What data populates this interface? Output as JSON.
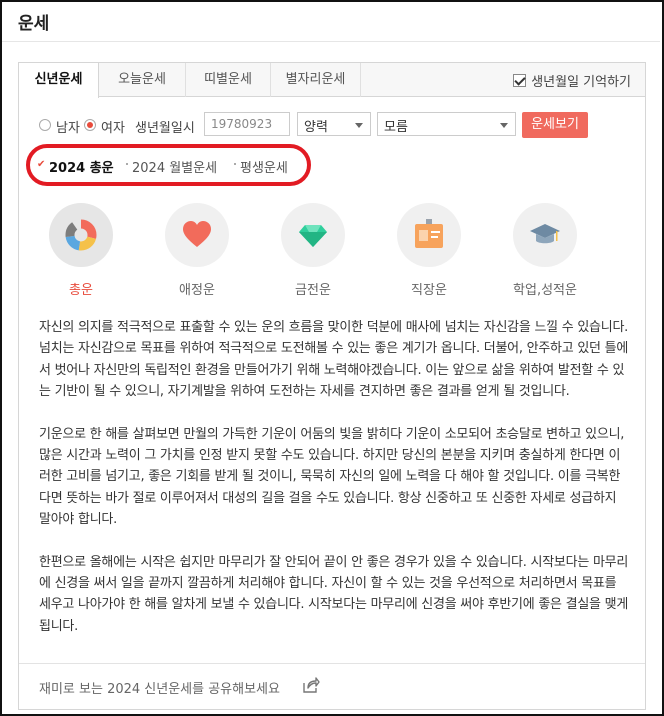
{
  "header": {
    "title": "운세"
  },
  "tabs": [
    {
      "label": "신년운세",
      "active": true
    },
    {
      "label": "오늘운세",
      "active": false
    },
    {
      "label": "띠별운세",
      "active": false
    },
    {
      "label": "별자리운세",
      "active": false
    }
  ],
  "remember_label": "생년월일 기억하기",
  "form": {
    "male_label": "남자",
    "female_label": "여자",
    "selected_gender": "여자",
    "birth_label": "생년월일시",
    "birth_placeholder": "19780923",
    "calendar_value": "양력",
    "time_value": "모름",
    "submit_label": "운세보기"
  },
  "subtabs": [
    {
      "label": "2024 총운",
      "active": true
    },
    {
      "label": "2024 월별운세",
      "active": false
    },
    {
      "label": "평생운세",
      "active": false
    }
  ],
  "categories": [
    {
      "label": "총운",
      "icon": "donut-chart-icon",
      "active": true
    },
    {
      "label": "애정운",
      "icon": "heart-icon",
      "active": false
    },
    {
      "label": "금전운",
      "icon": "gem-icon",
      "active": false
    },
    {
      "label": "직장운",
      "icon": "id-card-icon",
      "active": false
    },
    {
      "label": "학업,성적운",
      "icon": "graduation-cap-icon",
      "active": false
    }
  ],
  "content": {
    "paragraphs": [
      "자신의 의지를 적극적으로 표출할 수 있는 운의 흐름을 맞이한 덕분에 매사에 넘치는 자신감을 느낄 수 있습니다. 넘치는 자신감으로 목표를 위하여 적극적으로 도전해볼 수 있는 좋은 계기가 옵니다. 더불어, 안주하고 있던 틀에서 벗어나 자신만의 독립적인 환경을 만들어가기 위해 노력해야겠습니다. 이는 앞으로 삶을 위하여 발전할 수 있는 기반이 될 수 있으니, 자기계발을 위하여 도전하는 자세를 견지하면 좋은 결과를 얻게 될 것입니다.",
      "기운으로 한 해를 살펴보면 만월의 가득한 기운이 어둠의 빛을 밝히다 기운이 소모되어 초승달로 변하고 있으니, 많은 시간과 노력이 그 가치를 인정 받지 못할 수도 있습니다. 하지만 당신의 본분을 지키며 충실하게 한다면 이러한 고비를 넘기고, 좋은 기회를 받게 될 것이니, 묵묵히 자신의 일에 노력을 다 해야 할 것입니다. 이를 극복한다면 뜻하는 바가 절로 이루어져서 대성의 길을 걸을 수도 있습니다. 항상 신중하고 또 신중한 자세로 성급하지 말아야 합니다.",
      "한편으로 올해에는 시작은 쉽지만 마무리가 잘 안되어 끝이 안 좋은 경우가 있을 수 있습니다. 시작보다는 마무리에 신경을 써서 일을 끝까지 깔끔하게 처리해야 합니다. 자신이 할 수 있는 것을 우선적으로 처리하면서 목표를 세우고 나아가야 한 해를 알차게 보낼 수 있습니다. 시작보다는 마무리에 신경을 써야 후반기에 좋은 결실을 맺게 됩니다."
    ]
  },
  "footer": {
    "share_text": "재미로 보는 2024 신년운세를 공유해보세요"
  },
  "colors": {
    "accent": "#e84b3c",
    "button": "#f06a5e",
    "highlight_ring": "#e21b23"
  }
}
